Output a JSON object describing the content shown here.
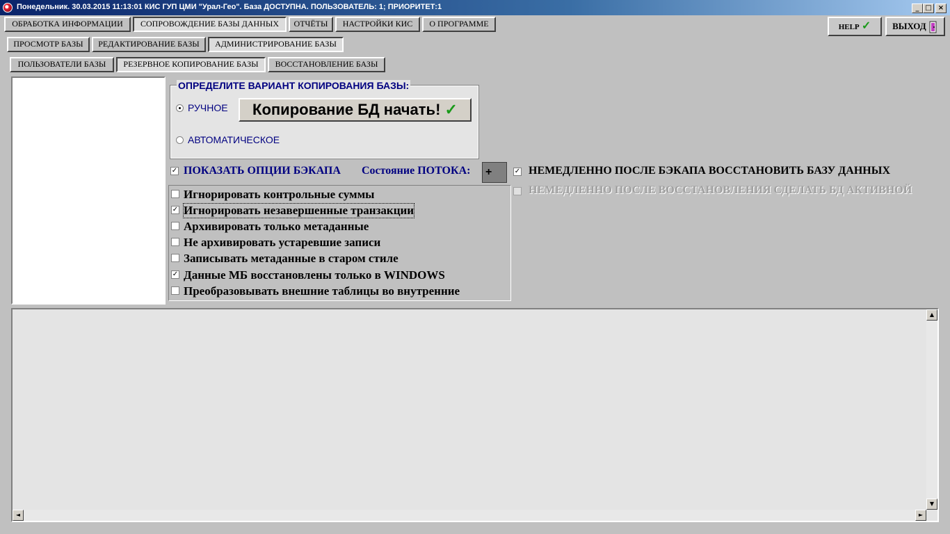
{
  "window": {
    "title": "Понедельник. 30.03.2015 11:13:01 КИС ГУП ЦМИ \"Урал-Гео\". База ДОСТУПНА. ПОЛЬЗОВАТЕЛЬ: 1; ПРИОРИТЕТ:1",
    "controls": {
      "minimize": "_",
      "maximize": "□",
      "close": "×"
    }
  },
  "main_tabs": [
    {
      "label": "ОБРАБОТКА ИНФОРМАЦИИ"
    },
    {
      "label": "СОПРОВОЖДЕНИЕ БАЗЫ ДАННЫХ"
    },
    {
      "label": "ОТЧЁТЫ"
    },
    {
      "label": "НАСТРОЙКИ КИС"
    },
    {
      "label": "О ПРОГРАММЕ"
    }
  ],
  "top_buttons": {
    "help": "HELP",
    "exit": "ВЫХОД"
  },
  "sub_tabs": [
    {
      "label": "ПРОСМОТР БАЗЫ"
    },
    {
      "label": "РЕДАКТИРОВАНИЕ БАЗЫ"
    },
    {
      "label": "АДМИНИСТРИРОВАНИЕ БАЗЫ"
    }
  ],
  "admin_tabs": [
    {
      "label": "ПОЛЬЗОВАТЕЛИ БАЗЫ"
    },
    {
      "label": "РЕЗЕРВНОЕ КОПИРОВАНИЕ БАЗЫ"
    },
    {
      "label": "ВОССТАНОВЛЕНИЕ БАЗЫ"
    }
  ],
  "copy_mode": {
    "legend": "ОПРЕДЕЛИТЕ ВАРИАНТ КОПИРОВАНИЯ БАЗЫ:",
    "manual": "РУЧНОЕ",
    "auto": "АВТОМАТИЧЕСКОЕ",
    "selected": "РУЧНОЕ",
    "start_button": "Копирование БД начать!"
  },
  "backup": {
    "show_options": "ПОКАЗАТЬ ОПЦИИ БЭКАПА",
    "show_options_checked": true,
    "status_label": "Состояние  ПОТОКА:",
    "status_value": "+",
    "restore_after": "НЕМЕДЛЕННО ПОСЛЕ БЭКАПА ВОССТАНОВИТЬ БАЗУ ДАННЫХ",
    "restore_after_checked": true,
    "activate_after": "НЕМЕДЛЕННО ПОСЛЕ ВОССТАНОВЛЕНИЯ СДЕЛАТЬ БД АКТИВНОЙ",
    "activate_after_checked": false
  },
  "options": [
    {
      "label": "Игнорировать контрольные суммы",
      "checked": false
    },
    {
      "label": "Игнорировать незавершенные транзакции",
      "checked": true
    },
    {
      "label": "Архивировать только метаданные",
      "checked": false
    },
    {
      "label": "Не архивировать устаревшие записи",
      "checked": false
    },
    {
      "label": "Записывать метаданные в старом стиле",
      "checked": false
    },
    {
      "label": "Данные МБ восстановлены только в WINDOWS",
      "checked": true
    },
    {
      "label": "Преобразовывать внешние таблицы во внутренние",
      "checked": false
    }
  ],
  "scroll": {
    "up": "▲",
    "down": "▼",
    "left": "◄",
    "right": "►"
  },
  "check_glyph": "✓",
  "colors": {
    "title_start": "#0a246a",
    "title_end": "#a6caf0",
    "label_blue": "#000080",
    "accent_green": "#1a9a1a"
  }
}
